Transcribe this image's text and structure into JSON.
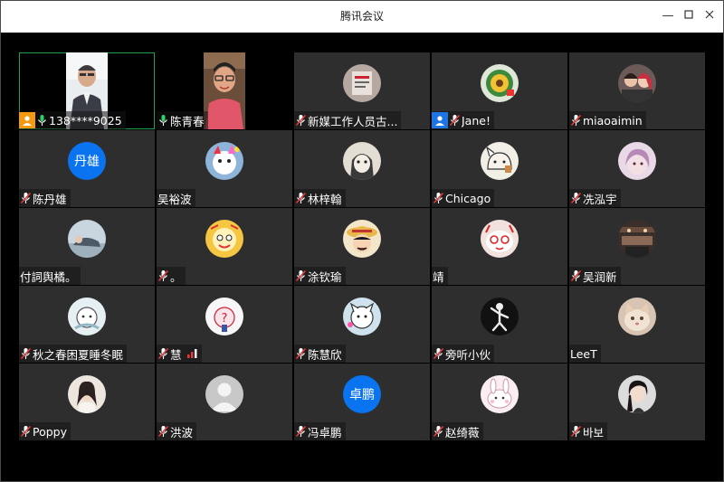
{
  "window": {
    "title": "腾讯会议"
  },
  "participants": [
    {
      "name": "138****9025",
      "kind": "video",
      "mic": "on",
      "host": true,
      "speaking": true
    },
    {
      "name": "陈青春",
      "kind": "video",
      "mic": "on"
    },
    {
      "name": "新媒工作人员古...",
      "kind": "avatar",
      "mic": "muted"
    },
    {
      "name": "Jane!",
      "kind": "avatar",
      "mic": "muted",
      "cohost": true
    },
    {
      "name": "miaoaimin",
      "kind": "avatar",
      "mic": "muted"
    },
    {
      "name": "陈丹雄",
      "kind": "initials",
      "initials": "丹雄",
      "mic": "muted"
    },
    {
      "name": "吴裕波",
      "kind": "avatar",
      "mic": "none"
    },
    {
      "name": "林梓翰",
      "kind": "avatar",
      "mic": "muted"
    },
    {
      "name": "Chicago",
      "kind": "avatar",
      "mic": "muted"
    },
    {
      "name": "冼泓宇",
      "kind": "avatar",
      "mic": "muted"
    },
    {
      "name": "付詞舆橘。",
      "kind": "avatar",
      "mic": "none"
    },
    {
      "name": "。",
      "kind": "avatar",
      "mic": "muted"
    },
    {
      "name": "涂钦瑜",
      "kind": "avatar",
      "mic": "muted"
    },
    {
      "name": "靖",
      "kind": "avatar",
      "mic": "none"
    },
    {
      "name": "吴润新",
      "kind": "avatar",
      "mic": "muted"
    },
    {
      "name": "秋之春困夏睡冬眠",
      "kind": "avatar",
      "mic": "muted"
    },
    {
      "name": "慧",
      "kind": "avatar",
      "mic": "muted",
      "signal": true
    },
    {
      "name": "陈慧欣",
      "kind": "avatar",
      "mic": "muted"
    },
    {
      "name": "旁听小伙",
      "kind": "avatar",
      "mic": "muted"
    },
    {
      "name": "LeeT",
      "kind": "avatar",
      "mic": "none"
    },
    {
      "name": "Poppy",
      "kind": "avatar",
      "mic": "muted"
    },
    {
      "name": "洪波",
      "kind": "avatar",
      "mic": "muted"
    },
    {
      "name": "冯卓鹏",
      "kind": "initials",
      "initials": "卓鹏",
      "mic": "muted"
    },
    {
      "name": "赵绮薇",
      "kind": "avatar",
      "mic": "muted"
    },
    {
      "name": "바보",
      "kind": "avatar",
      "mic": "muted"
    }
  ]
}
